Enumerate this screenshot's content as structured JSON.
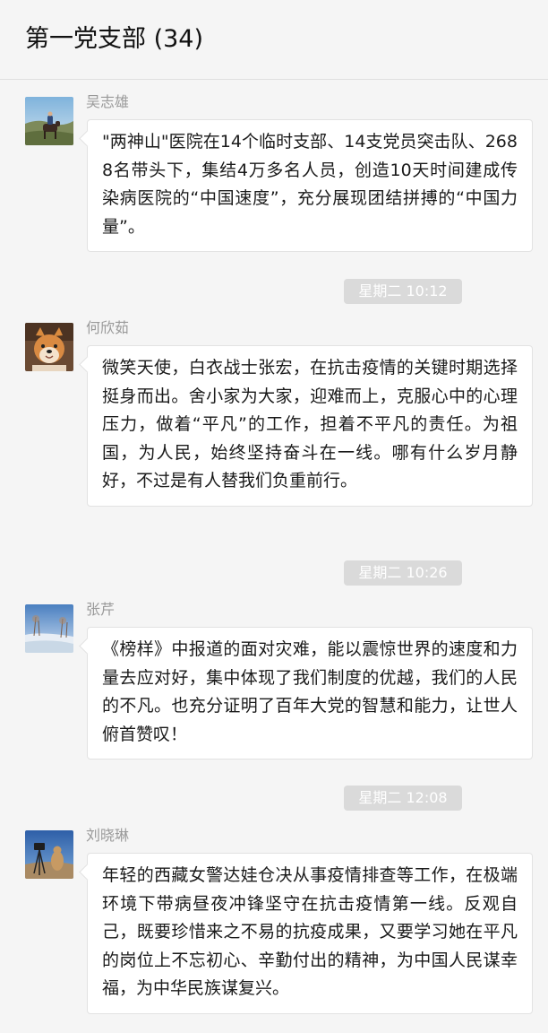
{
  "header": {
    "title": "第一党支部 (34)"
  },
  "colors": {
    "background": "#f5f5f5",
    "bubble": "#ffffff",
    "timestamp_bg": "#dadada",
    "sender_name": "#9a9a9a"
  },
  "messages": [
    {
      "sender": "吴志雄",
      "avatar": "horse-rider-photo",
      "text": "\"两神山\"医院在14个临时支部、14支党员突击队、2688名带头下，集结4万多名人员，创造10天时间建成传染病医院的“中国速度”，充分展现团结拼搏的“中国力量”。"
    },
    {
      "timestamp": "星期二 10:12",
      "sender": "何欣茹",
      "avatar": "shiba-dog-photo",
      "text": "微笑天使，白衣战士张宏，在抗击疫情的关键时期选择挺身而出。舍小家为大家，迎难而上，克服心中的心理压力，做着“平凡”的工作，担着不平凡的责任。为祖国，为人民，始终坚持奋斗在一线。哪有什么岁月静好，不过是有人替我们负重前行。"
    },
    {
      "timestamp": "星期二 10:26",
      "sender": "张芹",
      "avatar": "winter-landscape-photo",
      "text": "《榜样》中报道的面对灾难，能以震惊世界的速度和力量去应对好，集中体现了我们制度的优越，我们的人民的不凡。也充分证明了百年大党的智慧和能力，让世人俯首赞叹！"
    },
    {
      "timestamp": "星期二 12:08",
      "sender": "刘晓琳",
      "avatar": "camera-tripod-photo",
      "text": "年轻的西藏女警达娃仓决从事疫情排查等工作，在极端环境下带病昼夜冲锋坚守在抗击疫情第一线。反观自己，既要珍惜来之不易的抗疫成果，又要学习她在平凡的岗位上不忘初心、辛勤付出的精神，为中国人民谋幸福，为中华民族谋复兴。"
    }
  ]
}
